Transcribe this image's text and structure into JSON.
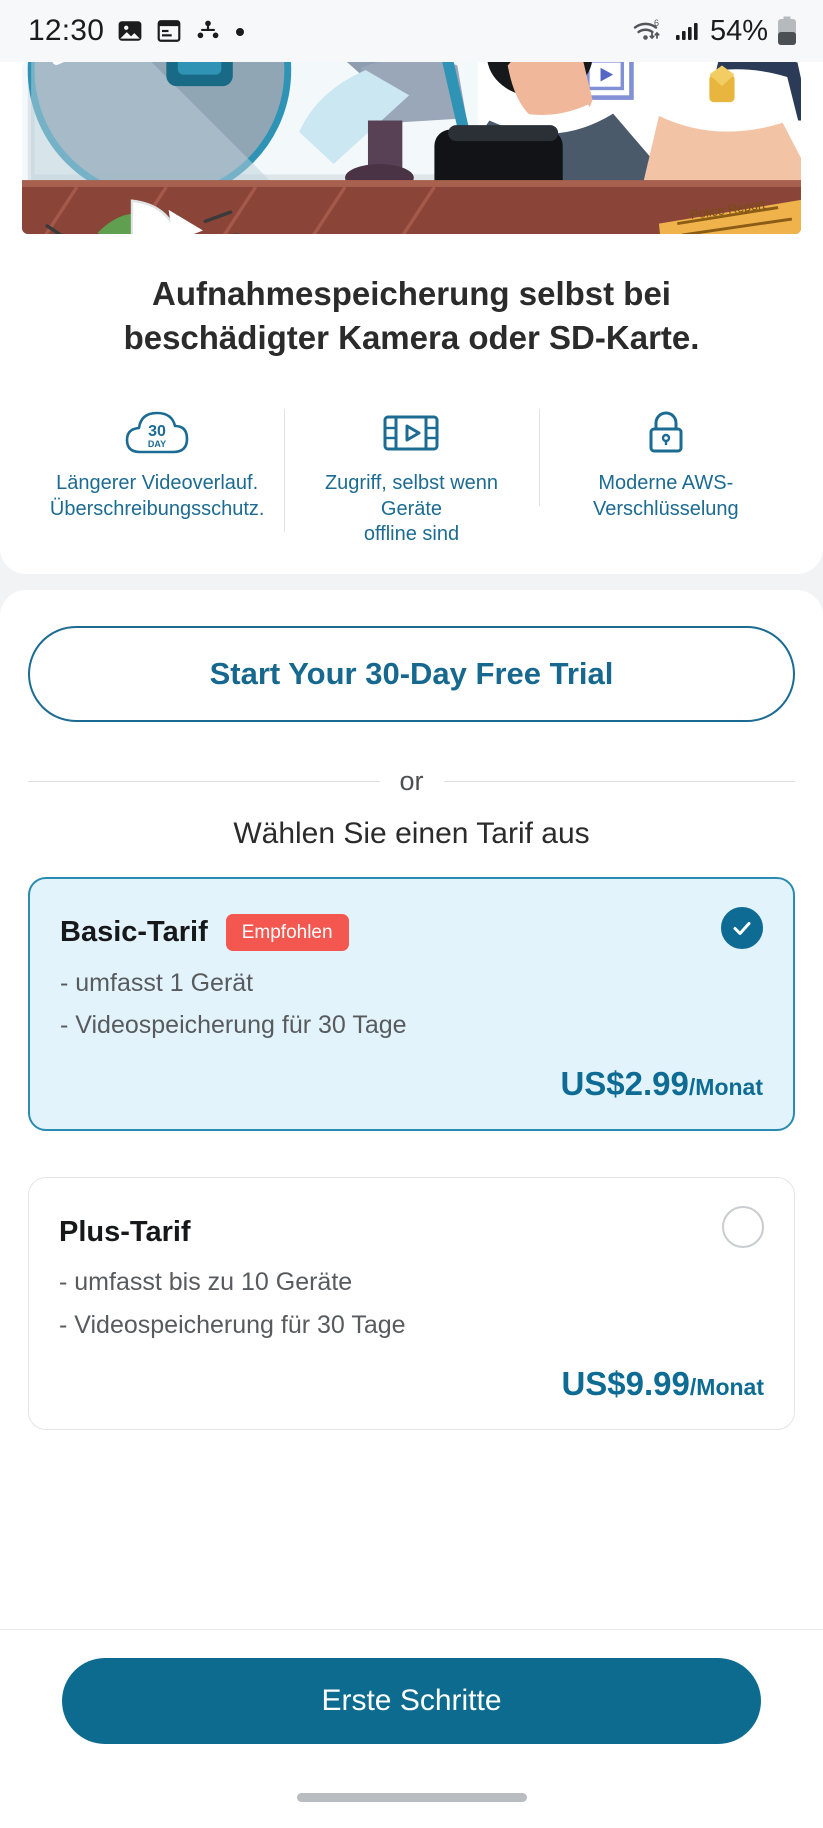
{
  "status_bar": {
    "time": "12:30",
    "left_icons": [
      "image-icon",
      "calendar-icon",
      "bluetooth-share-icon",
      "dot-icon"
    ],
    "right_icons": [
      "wifi-6-icon",
      "signal-bars-icon",
      "battery-icon"
    ],
    "battery_text": "54%"
  },
  "hero": {
    "alt_name": "office-illustration",
    "colors": {
      "floor": "#8a4438",
      "wall": "#ffffff",
      "accent": "#2e8bab",
      "suit": "#4a5a6b"
    }
  },
  "headline": {
    "line1": "Aufnahmespeicherung selbst bei",
    "line2": "beschädigter Kamera oder SD-Karte."
  },
  "features": [
    {
      "icon": "cloud-30-day-icon",
      "icon_text_top": "30",
      "icon_text_bottom": "DAY",
      "label_line1": "Längerer Videoverlauf.",
      "label_line2": "Überschreibungsschutz."
    },
    {
      "icon": "film-play-icon",
      "label_line1": "Zugriff, selbst wenn Geräte",
      "label_line2": "offline sind"
    },
    {
      "icon": "lock-icon",
      "label_line1": "Moderne AWS-",
      "label_line2": "Verschlüsselung"
    }
  ],
  "trial_button": {
    "label": "Start Your 30-Day Free Trial"
  },
  "divider": {
    "text": "or"
  },
  "choose_plan_title": "Wählen Sie einen Tarif aus",
  "plans": [
    {
      "name": "Basic-Tarif",
      "badge": "Empfohlen",
      "selected": true,
      "features": [
        "- umfasst 1 Gerät",
        "- Videospeicherung für 30 Tage"
      ],
      "price": "US$2.99",
      "price_period": "/Monat"
    },
    {
      "name": "Plus-Tarif",
      "badge": "",
      "selected": false,
      "features": [
        "- umfasst bis zu 10 Geräte",
        "- Videospeicherung für 30 Tage"
      ],
      "price": "US$9.99",
      "price_period": "/Monat"
    }
  ],
  "cta_button": {
    "label": "Erste Schritte"
  },
  "colors": {
    "accent": "#0d6b94",
    "badge": "#f4574f",
    "selected_bg": "#e3f3fb",
    "cta_bg": "#0d6b8f"
  }
}
